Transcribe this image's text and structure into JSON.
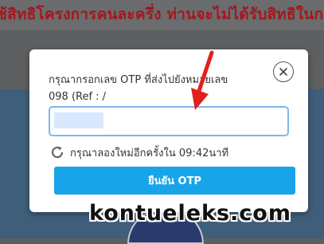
{
  "background": {
    "notice_text": "ช้สิทธิโครงการคนละครึ่ง ท่านจะไม่ได้รับสิทธิในก"
  },
  "otp_dialog": {
    "prompt_line1": "กรุณากรอกเลข OTP ที่ส่งไปยังหมายเลข",
    "prompt_line2": "098           (Ref : /",
    "otp_value": "",
    "resend_text": "กรุณาลองใหม่อีกครั้งใน 09:42นาที",
    "confirm_label": "ยืนยัน OTP",
    "close_icon": "close-icon",
    "refresh_icon": "refresh-icon"
  },
  "watermark": "kontueleks.com",
  "colors": {
    "accent": "#18a4e8",
    "annotation_arrow": "#e0211b",
    "notice_text": "#a6161c",
    "field_border": "#7fb6ef"
  }
}
